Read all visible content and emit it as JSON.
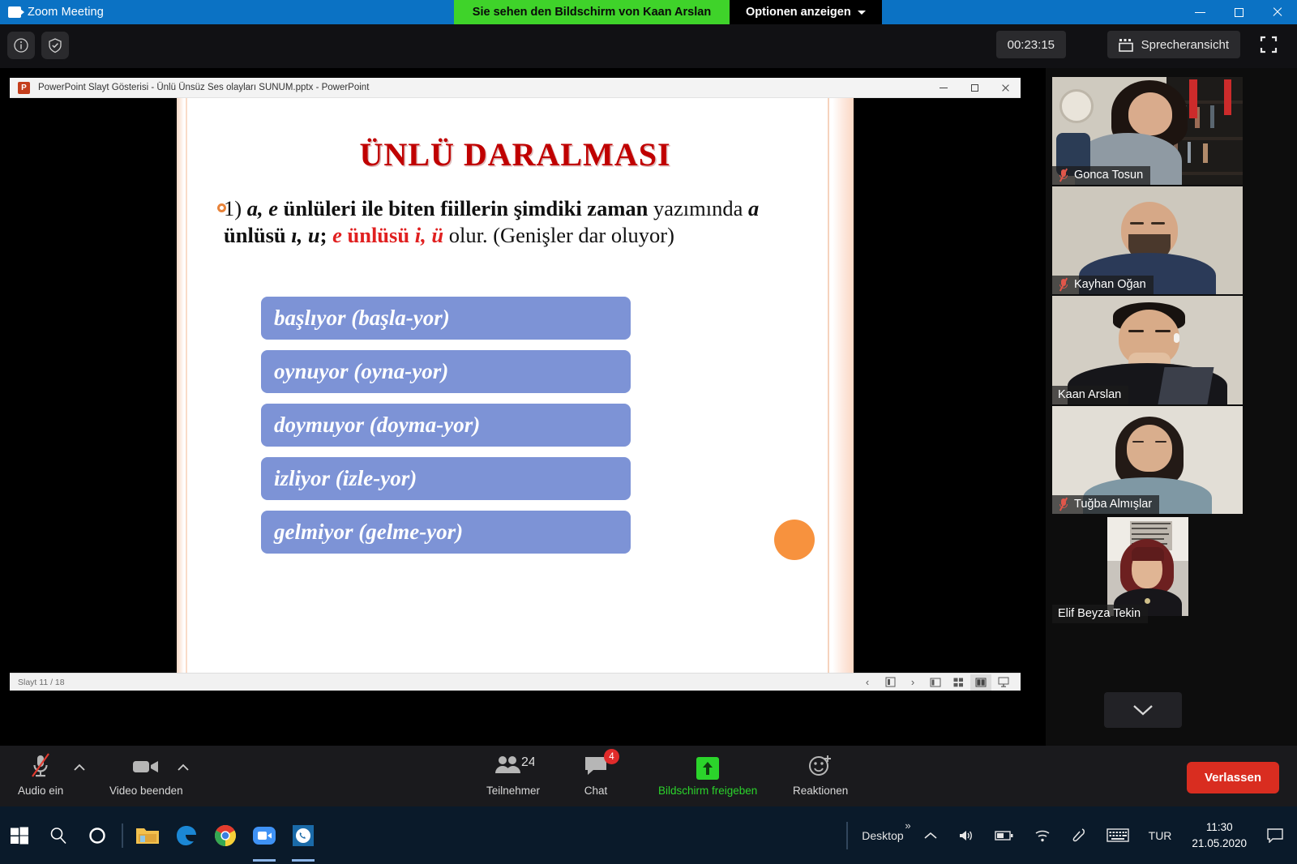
{
  "zoom_window": {
    "title": "Zoom Meeting",
    "share_banner": "Sie sehen den Bildschirm von Kaan Arslan",
    "share_options": "Optionen anzeigen",
    "window_buttons": {
      "minimize": "Minimieren",
      "restore": "Wiederherstellen",
      "close": "Schließen"
    }
  },
  "top_strip": {
    "info_icon": "info-icon",
    "shield_icon": "shield-check-icon",
    "timer": "00:23:15",
    "view_mode": "Sprecheransicht",
    "view_icon": "grid-view-icon",
    "fullscreen_icon": "fullscreen-icon"
  },
  "powerpoint": {
    "title": "PowerPoint Slayt Gösterisi  -  Ünlü Ünsüz Ses olayları SUNUM.pptx - PowerPoint",
    "app_icon_letter": "P",
    "status_text": "Slayt 11 / 18",
    "status_icons": [
      "prev-slide-icon",
      "slide-menu-icon",
      "next-slide-icon",
      "normal-view-icon",
      "slide-sorter-icon",
      "reading-view-icon",
      "slideshow-icon"
    ],
    "slide": {
      "title": "ÜNLÜ DARALMASI",
      "bullet_parts": [
        {
          "text": "1) ",
          "style": "normal"
        },
        {
          "text": "a, e",
          "style": "bold-italic"
        },
        {
          "text": " ünlüleri ile biten fiillerin şimdiki zaman",
          "style": "bold"
        },
        {
          "text": " yazımında ",
          "style": "normal"
        },
        {
          "text": "a",
          "style": "bold-italic"
        },
        {
          "text": " ünlüsü ",
          "style": "bold"
        },
        {
          "text": "ı, u",
          "style": "bold-italic"
        },
        {
          "text": "; ",
          "style": "bold"
        },
        {
          "text": "e",
          "style": "bold-italic-red"
        },
        {
          "text": " ünlüsü ",
          "style": "bold-red"
        },
        {
          "text": "i, ü",
          "style": "bold-italic-red"
        },
        {
          "text": " olur. (Genişler dar oluyor)",
          "style": "normal"
        }
      ],
      "examples": [
        "başlıyor (başla-yor)",
        "oynuyor (oyna-yor)",
        "doymuyor (doyma-yor)",
        "izliyor (izle-yor)",
        "gelmiyor (gelme-yor)"
      ],
      "annotation_dot": "orange-annotation-dot",
      "colors": {
        "title": "#c00000",
        "example_box": "#7d93d6",
        "accent_red": "#e02020",
        "annotation": "#f7923e"
      }
    }
  },
  "participants": [
    {
      "name": "Gonca Tosun",
      "muted": true,
      "active_speaker": false
    },
    {
      "name": "Kayhan Oğan",
      "muted": true,
      "active_speaker": false
    },
    {
      "name": "Kaan Arslan",
      "muted": false,
      "active_speaker": true
    },
    {
      "name": "Tuğba Almışlar",
      "muted": true,
      "active_speaker": false
    },
    {
      "name": "Elif Beyza Tekin",
      "muted": false,
      "active_speaker": false
    }
  ],
  "filmstrip": {
    "scroll_down_icon": "chevron-down-icon"
  },
  "toolbar": {
    "audio": {
      "label": "Audio ein",
      "icon": "microphone-muted-icon",
      "caret": "audio-options-caret"
    },
    "video": {
      "label": "Video beenden",
      "icon": "camera-icon",
      "caret": "video-options-caret"
    },
    "participants": {
      "label": "Teilnehmer",
      "count": "24",
      "icon": "participants-icon"
    },
    "chat": {
      "label": "Chat",
      "badge": "4",
      "icon": "chat-icon"
    },
    "share": {
      "label": "Bildschirm freigeben",
      "icon": "share-screen-icon",
      "color": "#2bd42b"
    },
    "reactions": {
      "label": "Reaktionen",
      "icon": "smiley-plus-icon"
    },
    "leave": {
      "label": "Verlassen",
      "color": "#d92d20"
    }
  },
  "taskbar": {
    "icons": [
      "windows-start-icon",
      "search-icon",
      "cortana-icon",
      "file-explorer-icon",
      "edge-icon",
      "chrome-icon",
      "zoom-icon",
      "whatsapp-icon"
    ],
    "tray": {
      "desktop_label": "Desktop",
      "overflow_icon": "chevron-up-icon",
      "expand_icon": "show-hidden-icons-icon",
      "volume_icon": "volume-icon",
      "battery_icon": "battery-icon",
      "wifi_icon": "wifi-icon",
      "pen_icon": "pen-icon",
      "keyboard_icon": "touch-keyboard-icon",
      "language": "TUR",
      "time": "11:30",
      "date": "21.05.2020",
      "notification_icon": "notification-icon"
    }
  }
}
